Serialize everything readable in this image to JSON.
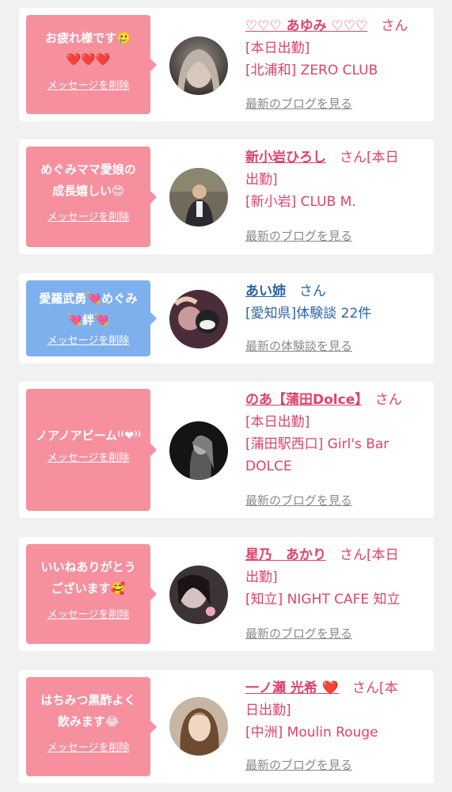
{
  "items": [
    {
      "bubble_line1": "お疲れ様です🥲",
      "bubble_line2": "❤️❤️❤️",
      "delete_label": "メッセージを削除",
      "name": "♡♡♡ あゆみ ♡♡♡",
      "san": "さん",
      "status": "[本日出勤]",
      "shop": "[北浦和] ZERO CLUB",
      "link": "最新のブログを見る"
    },
    {
      "bubble_line1": "めぐみママ愛娘の",
      "bubble_line2": "成長嬉しい😍",
      "delete_label": "メッセージを削除",
      "name": "新小岩ひろし",
      "san": "さん[本日",
      "status": "出勤]",
      "shop": "[新小岩] CLUB M.",
      "link": "最新のブログを見る"
    },
    {
      "bubble_line1": "愛羅武勇💘めぐみ",
      "bubble_line2": "💘絆💘",
      "delete_label": "メッセージを削除",
      "name": "あい姉",
      "san": "さん",
      "shop": "[愛知県]体験談 22件",
      "link": "最新の体験談を見る"
    },
    {
      "bubble_line1": "ノアノアビーム⁽⁽❤︎⁾⁾",
      "delete_label": "メッセージを削除",
      "name": "のあ【蒲田Dolce】",
      "san": "さん",
      "status": "[本日出勤]",
      "shop_line1": "[蒲田駅西口] Girl's Bar",
      "shop_line2": "DOLCE",
      "link": "最新のブログを見る"
    },
    {
      "bubble_line1": "いいねありがとう",
      "bubble_line2": "ございます🥰",
      "delete_label": "メッセージを削除",
      "name": "星乃　あかり",
      "san": "さん[本日",
      "status": "出勤]",
      "shop": "[知立] NIGHT CAFE 知立",
      "link": "最新のブログを見る"
    },
    {
      "bubble_line1": "はちみつ黒酢よく",
      "bubble_line2": "飲みます😂",
      "delete_label": "メッセージを削除",
      "name": "一ノ瀬 光希",
      "name_heart": "❤️",
      "san": "さん[本",
      "status": "日出勤]",
      "shop": "[中洲] Moulin Rouge",
      "link": "最新のブログを見る"
    }
  ],
  "colors": {
    "accent_pink": "#e0426a",
    "bubble_pink": "#f6909f",
    "bubble_blue": "#7fb0ee",
    "name_blue": "#2b63a8",
    "link_gray": "#8a8a8a"
  }
}
